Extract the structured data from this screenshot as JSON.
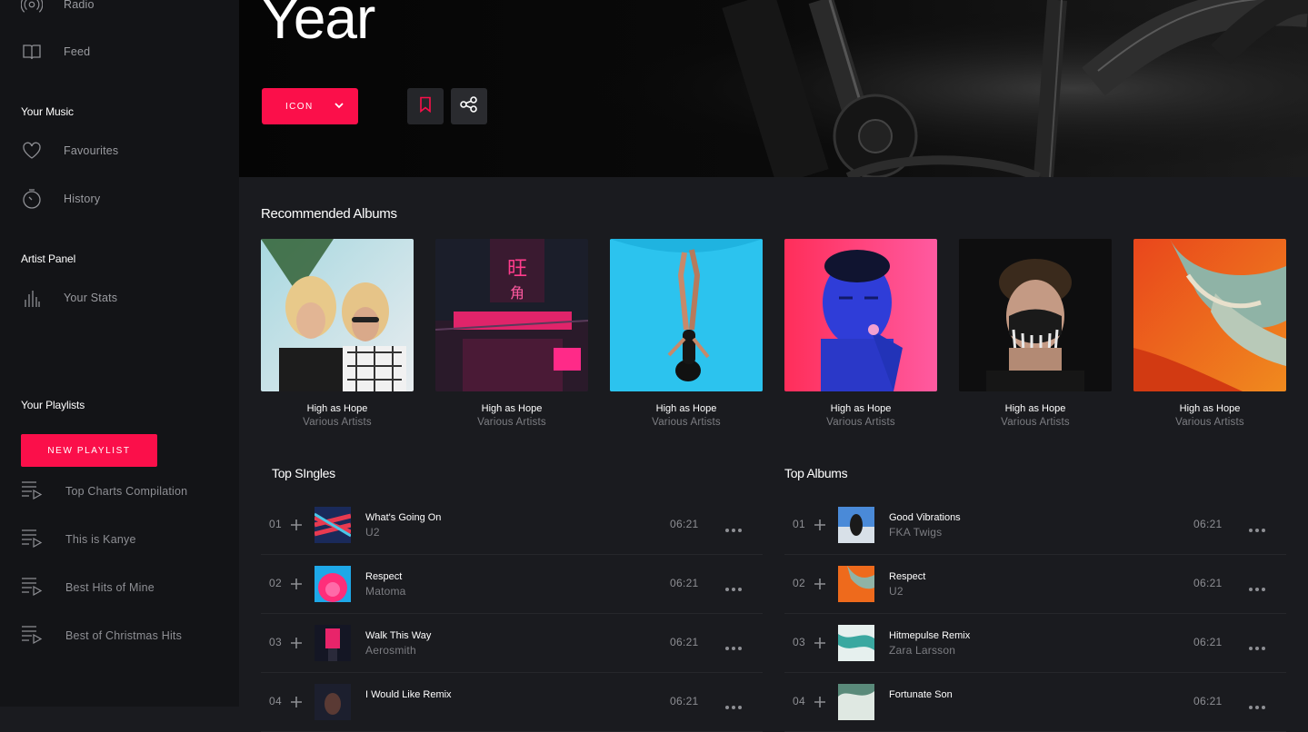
{
  "sidebar": {
    "nav": [
      {
        "label": "Radio",
        "icon": "radio-icon"
      },
      {
        "label": "Feed",
        "icon": "book-icon"
      }
    ],
    "your_music": {
      "heading": "Your Music",
      "items": [
        {
          "label": "Favourites",
          "icon": "heart-icon"
        },
        {
          "label": "History",
          "icon": "history-icon"
        }
      ]
    },
    "artist_panel": {
      "heading": "Artist Panel",
      "items": [
        {
          "label": "Your Stats",
          "icon": "stats-icon"
        }
      ]
    },
    "playlists": {
      "heading": "Your Playlists",
      "new_button": "NEW PLAYLIST",
      "items": [
        {
          "label": "Top Charts Compilation"
        },
        {
          "label": "This is Kanye"
        },
        {
          "label": "Best Hits of Mine"
        },
        {
          "label": "Best of Christmas Hits"
        }
      ]
    }
  },
  "hero": {
    "title": "Year",
    "primary_button": "ICON",
    "accent_color": "#fb0f4a"
  },
  "recommended": {
    "title": "Recommended Albums",
    "albums": [
      {
        "title": "High as Hope",
        "artist": "Various Artists"
      },
      {
        "title": "High as Hope",
        "artist": "Various Artists"
      },
      {
        "title": "High as Hope",
        "artist": "Various Artists"
      },
      {
        "title": "High as Hope",
        "artist": "Various Artists"
      },
      {
        "title": "High as Hope",
        "artist": "Various Artists"
      },
      {
        "title": "High as Hope",
        "artist": "Various Artists"
      }
    ]
  },
  "top_singles": {
    "title": "Top SIngles",
    "tracks": [
      {
        "num": "01",
        "name": "What's Going On",
        "artist": "U2",
        "duration": "06:21"
      },
      {
        "num": "02",
        "name": "Respect",
        "artist": "Matoma",
        "duration": "06:21"
      },
      {
        "num": "03",
        "name": "Walk This Way",
        "artist": "Aerosmith",
        "duration": "06:21"
      },
      {
        "num": "04",
        "name": "I Would Like Remix",
        "artist": "",
        "duration": "06:21"
      }
    ]
  },
  "top_albums": {
    "title": "Top Albums",
    "tracks": [
      {
        "num": "01",
        "name": "Good Vibrations",
        "artist": "FKA Twigs",
        "duration": "06:21"
      },
      {
        "num": "02",
        "name": "Respect",
        "artist": "U2",
        "duration": "06:21"
      },
      {
        "num": "03",
        "name": "Hitmepulse Remix",
        "artist": "Zara Larsson",
        "duration": "06:21"
      },
      {
        "num": "04",
        "name": "Fortunate Son",
        "artist": "",
        "duration": "06:21"
      }
    ]
  }
}
